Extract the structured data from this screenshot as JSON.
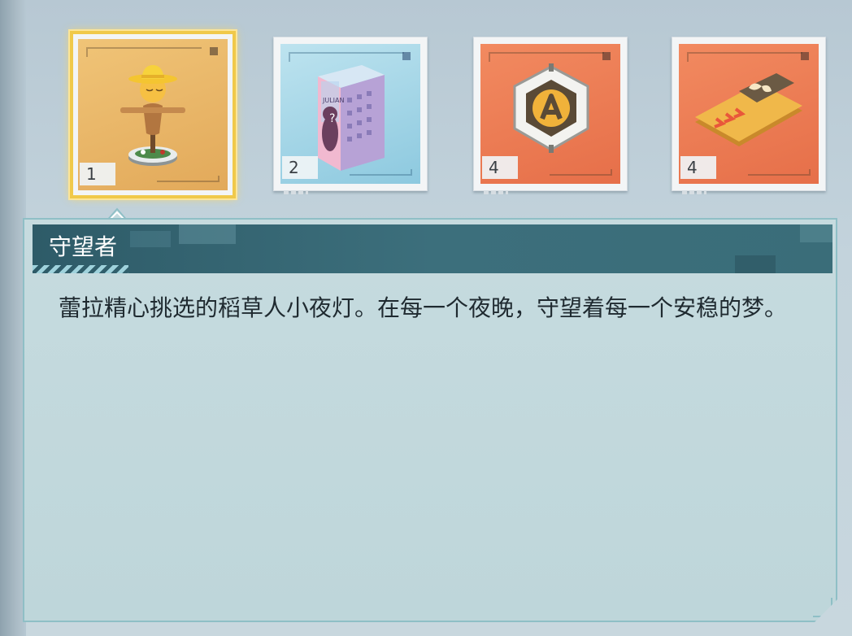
{
  "items": [
    {
      "name": "scarecrow-night-light",
      "quantity": "1",
      "selected": true,
      "bg": "#e9b768"
    },
    {
      "name": "julian-mystery-box",
      "quantity": "2",
      "selected": false,
      "bg": "#9fd3e6"
    },
    {
      "name": "hexagon-badge",
      "quantity": "4",
      "selected": false,
      "bg": "#ec7d55"
    },
    {
      "name": "butterfly-card",
      "quantity": "4",
      "selected": false,
      "bg": "#ec7d55"
    }
  ],
  "box_label": "JULIAN",
  "detail": {
    "title": "守望者",
    "description": "蕾拉精心挑选的稻草人小夜灯。在每一个夜晚，守望着每一个安稳的梦。"
  },
  "colors": {
    "panel_header": "#2e5b68",
    "panel_bg": "#c3d9dd",
    "selection": "#f0c94a"
  }
}
